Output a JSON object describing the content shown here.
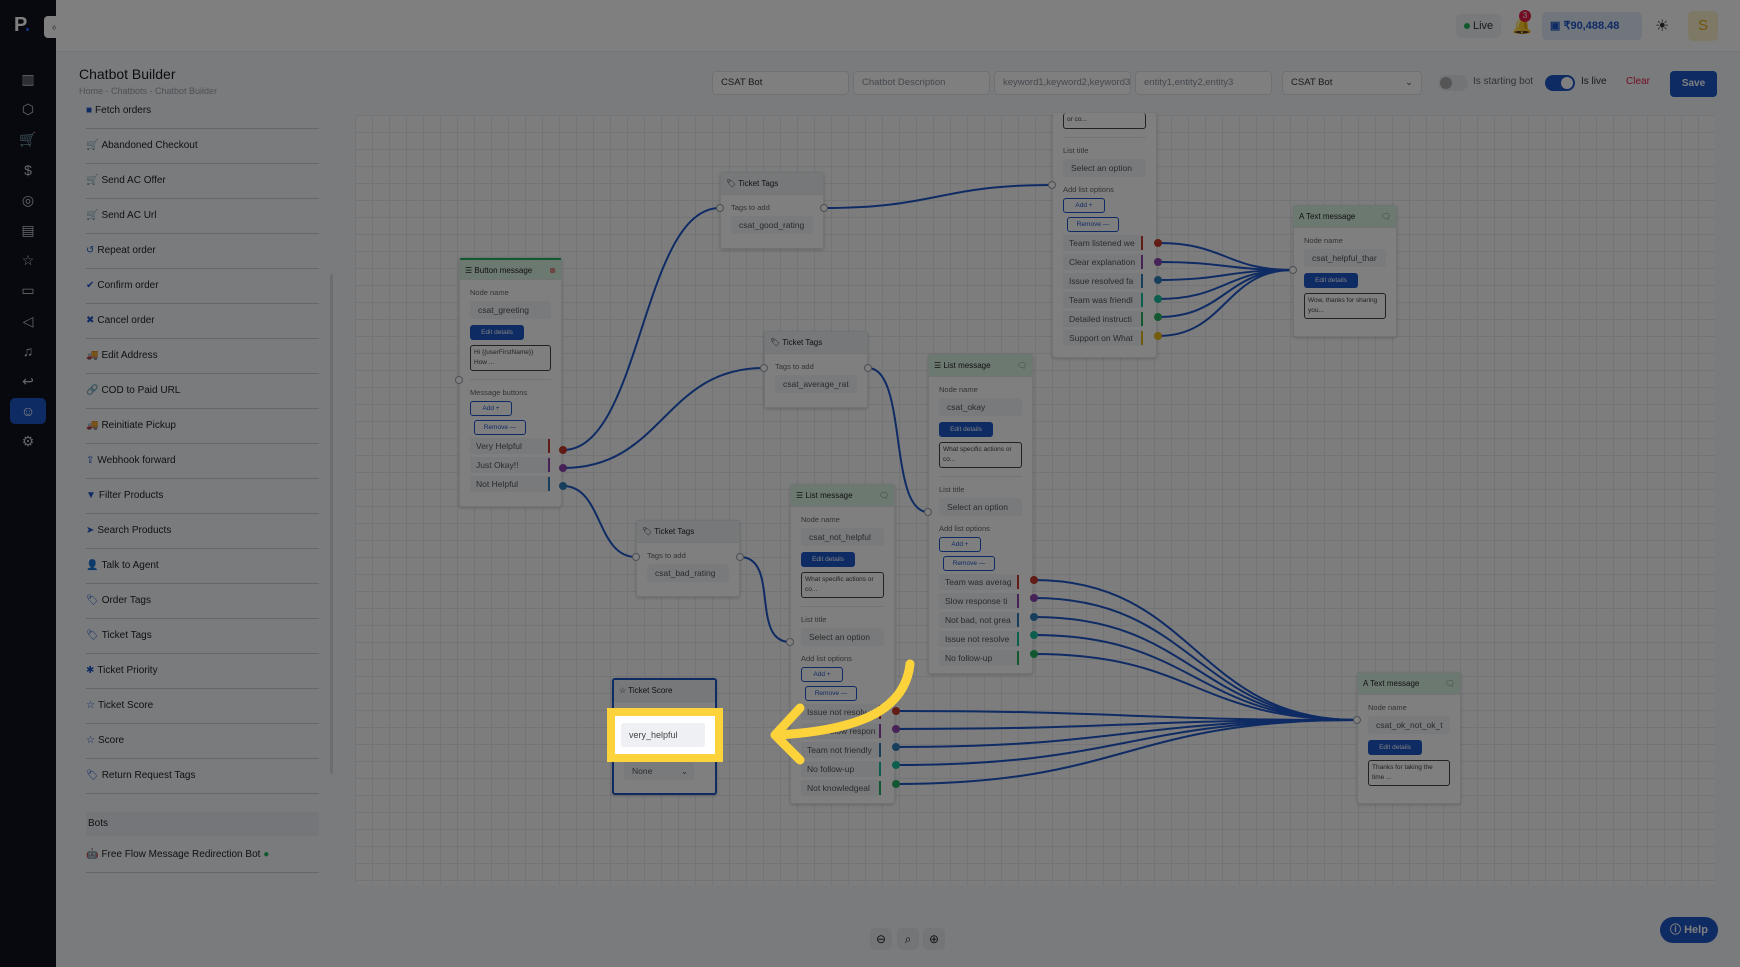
{
  "app": {
    "logo": "P",
    "collapse_icon": "«",
    "title": "Chatbot Builder",
    "breadcrumb": "Home  -  Chatbots  -  Chatbot Builder"
  },
  "rail": [
    "chart-icon",
    "box-icon",
    "cart-icon",
    "dollar-icon",
    "location-icon",
    "clipboard-icon",
    "star-icon",
    "chat-icon",
    "megaphone-icon",
    "bell-icon",
    "return-icon",
    "bot-icon",
    "gear-icon"
  ],
  "topbar": {
    "live": "Live",
    "notifications": "3",
    "wallet": "₹90,488.48",
    "avatar": "S"
  },
  "toolbar": {
    "name_value": "CSAT Bot",
    "description_placeholder": "Chatbot Description",
    "keywords_placeholder": "keyword1,keyword2,keyword3",
    "entities_placeholder": "entity1,entity2,entity3",
    "bot_select": "CSAT Bot",
    "starting_label": "Is starting bot",
    "starting_on": false,
    "live_label": "Is live",
    "live_on": true,
    "clear": "Clear",
    "save": "Save"
  },
  "palette": {
    "items": [
      {
        "icon": "■",
        "label": "Fetch orders"
      },
      {
        "icon": "🛒",
        "label": "Abandoned Checkout"
      },
      {
        "icon": "🛒",
        "label": "Send AC Offer"
      },
      {
        "icon": "🛒",
        "label": "Send AC Url"
      },
      {
        "icon": "↺",
        "label": "Repeat order"
      },
      {
        "icon": "✔",
        "label": "Confirm order"
      },
      {
        "icon": "✖",
        "label": "Cancel order"
      },
      {
        "icon": "🚚",
        "label": "Edit Address"
      },
      {
        "icon": "🔗",
        "label": "COD to Paid URL"
      },
      {
        "icon": "🚚",
        "label": "Reinitiate Pickup"
      },
      {
        "icon": "⇪",
        "label": "Webhook forward"
      },
      {
        "icon": "▼",
        "label": "Filter Products"
      },
      {
        "icon": "➤",
        "label": "Search Products"
      },
      {
        "icon": "👤",
        "label": "Talk to Agent"
      },
      {
        "icon": "🏷",
        "label": "Order Tags"
      },
      {
        "icon": "🏷",
        "label": "Ticket Tags"
      },
      {
        "icon": "✱",
        "label": "Ticket Priority"
      },
      {
        "icon": "☆",
        "label": "Ticket Score"
      },
      {
        "icon": "☆",
        "label": "Score"
      },
      {
        "icon": "🏷",
        "label": "Return Request Tags"
      }
    ],
    "bots_section": "Bots",
    "bots": [
      {
        "label": "Free Flow Message Redirection Bot",
        "status": "active"
      }
    ]
  },
  "nodes": {
    "button_message": {
      "title": "Button message",
      "node_name_label": "Node name",
      "node_name": "csat_greeting",
      "edit": "Edit details",
      "text": "Hi {{userFirstName}} How ...",
      "buttons_label": "Message buttons",
      "add": "Add +",
      "remove": "Remove —",
      "options": [
        "Very Helpful",
        "Just Okay!!",
        "Not Helpful"
      ]
    },
    "tags_good": {
      "title": "Ticket Tags",
      "label": "Tags to add",
      "value": "csat_good_rating"
    },
    "tags_average": {
      "title": "Ticket Tags",
      "label": "Tags to add",
      "value": "csat_average_rat"
    },
    "tags_bad": {
      "title": "Ticket Tags",
      "label": "Tags to add",
      "value": "csat_bad_rating"
    },
    "list_helpful": {
      "text_tail": "or co...",
      "list_title_label": "List title",
      "list_title": "Select an option",
      "options_label": "Add list options",
      "add": "Add +",
      "remove": "Remove —",
      "options": [
        "Team listened we",
        "Clear explanation",
        "Issue resolved fa",
        "Team was friendl",
        "Detailed instructi",
        "Support on What"
      ]
    },
    "list_okay": {
      "title": "List message",
      "node_name_label": "Node name",
      "node_name": "csat_okay",
      "edit": "Edit details",
      "text": "What specific actions or co...",
      "list_title_label": "List title",
      "list_title": "Select an option",
      "options_label": "Add list options",
      "add": "Add +",
      "remove": "Remove —",
      "options": [
        "Team was averag",
        "Slow response ti",
        "Not bad, not grea",
        "Issue not resolve",
        "No follow-up"
      ]
    },
    "list_not_helpful": {
      "title": "List message",
      "node_name_label": "Node name",
      "node_name": "csat_not_helpful",
      "edit": "Edit details",
      "text": "What specific actions or co...",
      "list_title_label": "List title",
      "list_title": "Select an option",
      "options_label": "Add list options",
      "add": "Add +",
      "remove": "Remove —",
      "options": [
        "Issue not resolv",
        "Team slow respon",
        "Team not friendly",
        "No follow-up",
        "Not knowledgeal"
      ]
    },
    "text_helpful": {
      "title": "Text message",
      "node_name_label": "Node name",
      "node_name": "csat_helpful_thar",
      "edit": "Edit details",
      "text": "Wow, thanks for sharing you..."
    },
    "text_ok": {
      "title": "Text message",
      "node_name_label": "Node name",
      "node_name": "csat_ok_not_ok_t",
      "edit": "Edit details",
      "text": "Thanks for taking the time ..."
    },
    "ticket_score": {
      "title": "Ticket Score",
      "value": "very_helpful",
      "select": "None"
    }
  },
  "colors": {
    "accent": "#1e56c8",
    "port_colors": [
      "#c0392b",
      "#8e44ad",
      "#2e7fb8",
      "#1abc9c",
      "#27ae60",
      "#e5b41d"
    ],
    "highlight": "#fdd33b"
  },
  "footer": {
    "help": "Help"
  }
}
